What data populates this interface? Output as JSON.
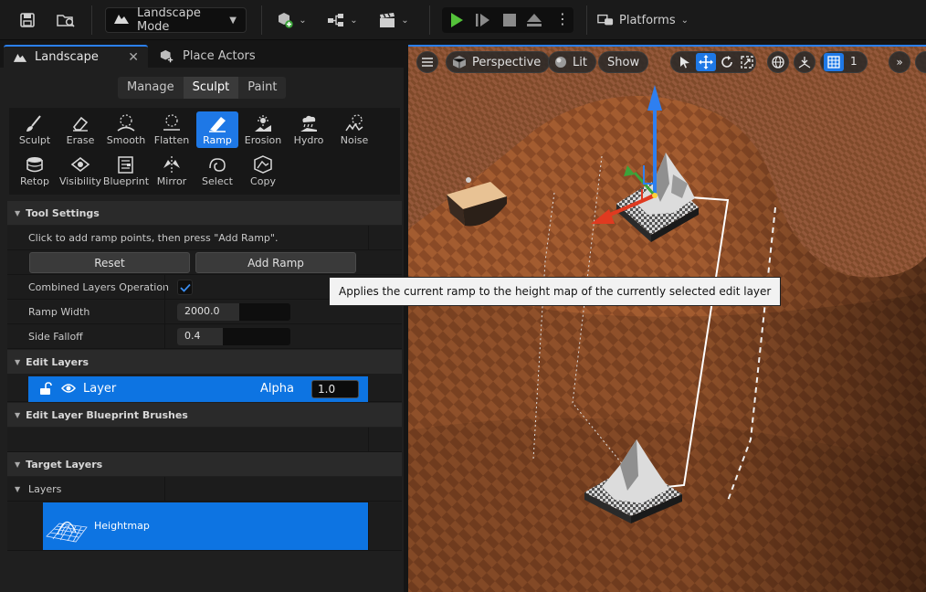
{
  "toolbar": {
    "mode_label": "Landscape Mode",
    "platforms_label": "Platforms",
    "colors": {
      "play": "#54c23a"
    }
  },
  "panel_tabs": [
    {
      "label": "Landscape",
      "active": true,
      "icon": "landscape-mode-icon"
    },
    {
      "label": "Place Actors",
      "active": false,
      "icon": "place-actors-icon"
    }
  ],
  "modes": [
    "Manage",
    "Sculpt",
    "Paint"
  ],
  "active_mode": "Sculpt",
  "tools": [
    {
      "label": "Sculpt",
      "icon": "sculpt-brush-icon"
    },
    {
      "label": "Erase",
      "icon": "eraser-icon"
    },
    {
      "label": "Smooth",
      "icon": "smooth-icon"
    },
    {
      "label": "Flatten",
      "icon": "flatten-icon"
    },
    {
      "label": "Ramp",
      "icon": "ramp-icon",
      "active": true
    },
    {
      "label": "Erosion",
      "icon": "erosion-icon"
    },
    {
      "label": "Hydro",
      "icon": "hydro-icon"
    },
    {
      "label": "Noise",
      "icon": "noise-icon"
    },
    {
      "label": "Retop",
      "icon": "retopologize-icon"
    },
    {
      "label": "Visibility",
      "icon": "visibility-icon"
    },
    {
      "label": "Blueprint",
      "icon": "blueprint-icon"
    },
    {
      "label": "Mirror",
      "icon": "mirror-icon"
    },
    {
      "label": "Select",
      "icon": "select-icon"
    },
    {
      "label": "Copy",
      "icon": "copy-icon"
    }
  ],
  "tool_settings": {
    "title": "Tool Settings",
    "hint": "Click to add ramp points, then press \"Add Ramp\".",
    "reset_label": "Reset",
    "add_ramp_label": "Add Ramp",
    "combined_label": "Combined Layers Operation",
    "combined_checked": true,
    "ramp_width_label": "Ramp Width",
    "ramp_width_value": "2000.0",
    "side_falloff_label": "Side Falloff",
    "side_falloff_value": "0.4",
    "side_falloff_fraction": 0.4
  },
  "edit_layers": {
    "title": "Edit Layers",
    "layer_name": "Layer",
    "alpha_label": "Alpha",
    "alpha_value": "1.0"
  },
  "blueprint_brushes": {
    "title": "Edit Layer Blueprint Brushes"
  },
  "target_layers": {
    "title": "Target Layers",
    "layers_label": "Layers",
    "heightmap_label": "Heightmap"
  },
  "tooltip": "Applies the current ramp to the height map of the currently selected edit layer",
  "viewport": {
    "perspective_label": "Perspective",
    "lit_label": "Lit",
    "show_label": "Show",
    "grid_value": "1",
    "accent": "#1e78e6"
  }
}
